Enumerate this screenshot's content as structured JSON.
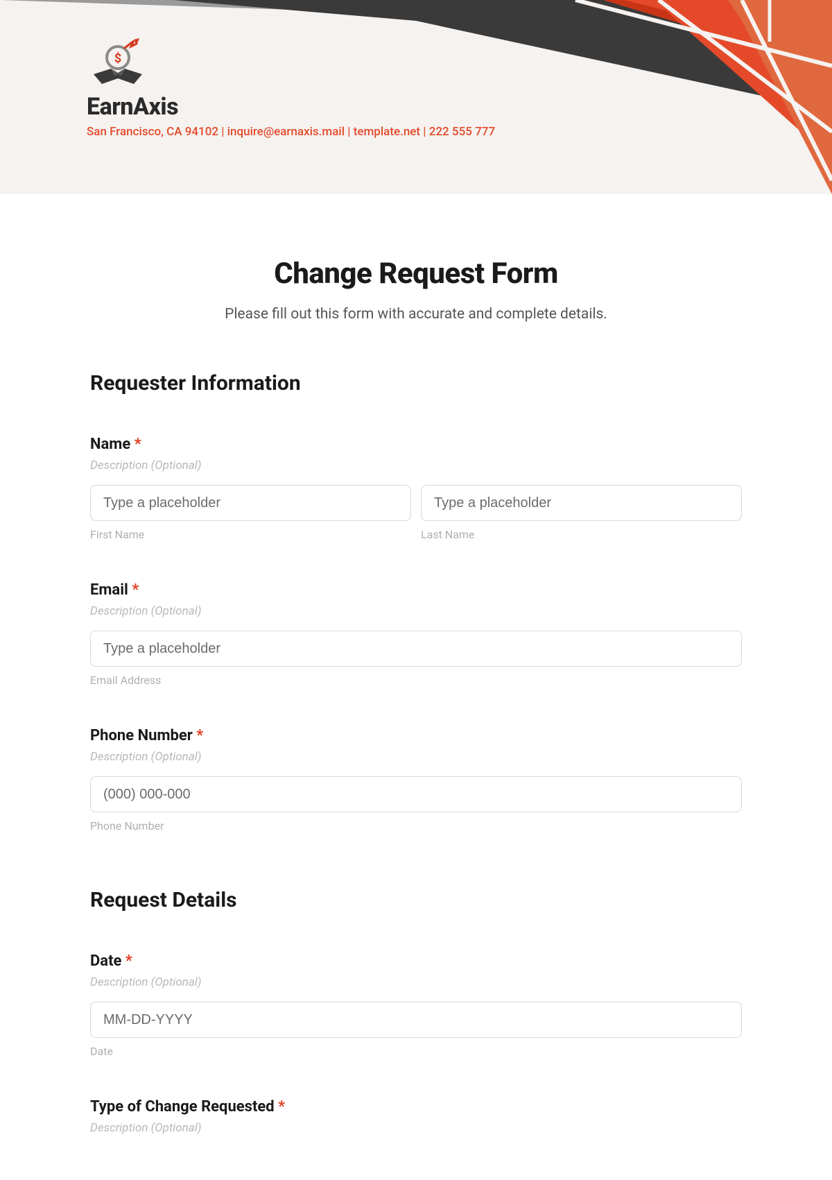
{
  "brand": {
    "name": "EarnAxis",
    "contact": "San Francisco, CA 94102 | inquire@earnaxis.mail | template.net | 222 555 777"
  },
  "form": {
    "title": "Change Request Form",
    "subtitle": "Please fill out this form with accurate and complete details."
  },
  "sections": {
    "requester": "Requester Information",
    "details": "Request Details"
  },
  "fields": {
    "name": {
      "label": "Name",
      "required": "*",
      "desc": "Description (Optional)",
      "first_placeholder": "Type a placeholder",
      "first_sub": "First Name",
      "last_placeholder": "Type a placeholder",
      "last_sub": "Last Name"
    },
    "email": {
      "label": "Email",
      "required": "*",
      "desc": "Description (Optional)",
      "placeholder": "Type a placeholder",
      "sub": "Email Address"
    },
    "phone": {
      "label": "Phone Number",
      "required": "*",
      "desc": "Description (Optional)",
      "placeholder": "(000) 000-000",
      "sub": "Phone Number"
    },
    "date": {
      "label": "Date",
      "required": "*",
      "desc": "Description (Optional)",
      "placeholder": "MM-DD-YYYY",
      "sub": "Date"
    },
    "change_type": {
      "label": "Type of Change Requested",
      "required": "*",
      "desc": "Description (Optional)"
    }
  }
}
